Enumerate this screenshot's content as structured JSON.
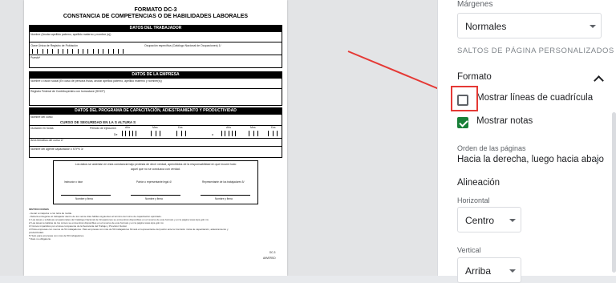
{
  "form": {
    "title_line1": "FORMATO DC-3",
    "title_line2": "CONSTANCIA DE COMPETENCIAS O DE HABILIDADES LABORALES",
    "sec_worker": "DATOS DEL TRABAJADOR",
    "f_name": "Nombre (Anotar apellido paterno, apellido materno y nombre (s))",
    "f_curp": "Clave Única de Registro de Población",
    "f_occupation": "Ocupación específica (Catálogo Nacional de Ocupaciones) 1/",
    "f_puesto": "Puesto*",
    "sec_company": "DATOS DE LA EMPRESA",
    "f_company": "Nombre o razón social (En caso de persona física, anotar apellido paterno, apellido materno y nombre(s))",
    "f_rfc": "Registro Federal de Contribuyentes con homoclave (SHCP)",
    "sec_program": "DATOS DEL PROGRAMA DE CAPACITACIÓN, ADIESTRAMIENTO Y PRODUCTIVIDAD",
    "f_course": "Nombre del curso",
    "course_value": "CURSO DE SEGURIDAD EN LA S ALTURA S",
    "f_duration": "Duración en horas",
    "f_period": "Periodo de ejecución",
    "f_from": "De",
    "f_to": "a",
    "f_year": "Año",
    "f_month": "Mes",
    "f_day": "Día",
    "f_area": "Área temática del curso 2/",
    "f_agent": "Nombre del agente capacitador o STPS 3/",
    "declaration_1": "Los datos se asientan en esta constancia bajo protesta de decir verdad, apercibidos de la responsabilidad en que incurre todo",
    "declaration_2": "aquel que no se conduzca con verdad.",
    "sig_instructor": "Instructor o tutor",
    "sig_employer": "Patrón o representante legal 4/",
    "sig_workers": "Representante de los trabajadores 5/",
    "sig_name": "Nombre y firma",
    "instr_title": "INSTRUCCIONES",
    "instr_1": "- Llenar a máquina o con letra de molde.",
    "instr_2": "- Deberá entregarse al trabajador dentro de los veinte días hábiles siguientes al término del curso de capacitación aprobado.",
    "instr_3": "1/ Las áreas y subáreas ocupacionales del Catálogo Nacional de Ocupaciones se encuentran disponibles en el reverso de este formato y en la página www.stps.gob.mx",
    "instr_4": "2/ Las áreas temáticas de los cursos se encuentran disponibles en el reverso de este formato y en la página www.stps.gob.mx",
    "instr_5": "3/ Cursos impartidos por el área competente de la Secretaría del Trabajo y Previsión Social.",
    "instr_6": "4/ Para empresas con menos de 51 trabajadores. Para empresas con más de 50 trabajadores firmará el representante del patrón ante la Comisión mixta de capacitación, adiestramiento y",
    "instr_7": "productividad.",
    "instr_8": "5/ Solo para empresas con más de 50 trabajadores.",
    "instr_9": "* Dato no obligatorio.",
    "footer_code": "DC-3",
    "footer_side": "ANVERSO"
  },
  "sidebar": {
    "margins_label": "Márgenes",
    "margins_value": "Normales",
    "page_breaks": "SALTOS DE PÁGINA PERSONALIZADOS",
    "format_heading": "Formato",
    "show_gridlines": "Mostrar líneas de cuadrícula",
    "show_gridlines_checked": false,
    "show_notes": "Mostrar notas",
    "show_notes_checked": true,
    "page_order_label": "Orden de las páginas",
    "page_order_value": "Hacia la derecha, luego hacia abajo",
    "alignment_heading": "Alineación",
    "horizontal_label": "Horizontal",
    "horizontal_value": "Centro",
    "vertical_label": "Vertical",
    "vertical_value": "Arriba"
  },
  "colors": {
    "accent_green": "#188038",
    "highlight_red": "#e53935"
  }
}
